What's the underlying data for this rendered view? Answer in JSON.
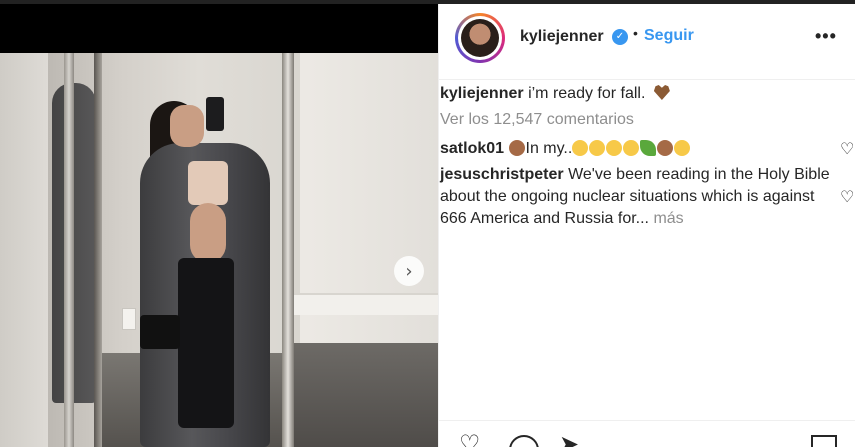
{
  "post": {
    "username": "kyliejenner",
    "follow_label": "Seguir",
    "dot": "•",
    "more_label": "•••",
    "next_arrow": "›",
    "caption_user": "kyliejenner",
    "caption_text": "i’m ready for fall.",
    "view_comments": "Ver los 12,547 comentarios",
    "verified_mark": "✓"
  },
  "comments": [
    {
      "user": "satlok01",
      "text": "In my.."
    },
    {
      "user": "jesuschristpeter",
      "text": "We've been reading in the Holy Bible about the ongoing nuclear situations which is against 666 America and Russia for...",
      "more": "más"
    }
  ],
  "icons": {
    "comment_like": "♡",
    "action_like": "♡",
    "action_share": "➤"
  }
}
